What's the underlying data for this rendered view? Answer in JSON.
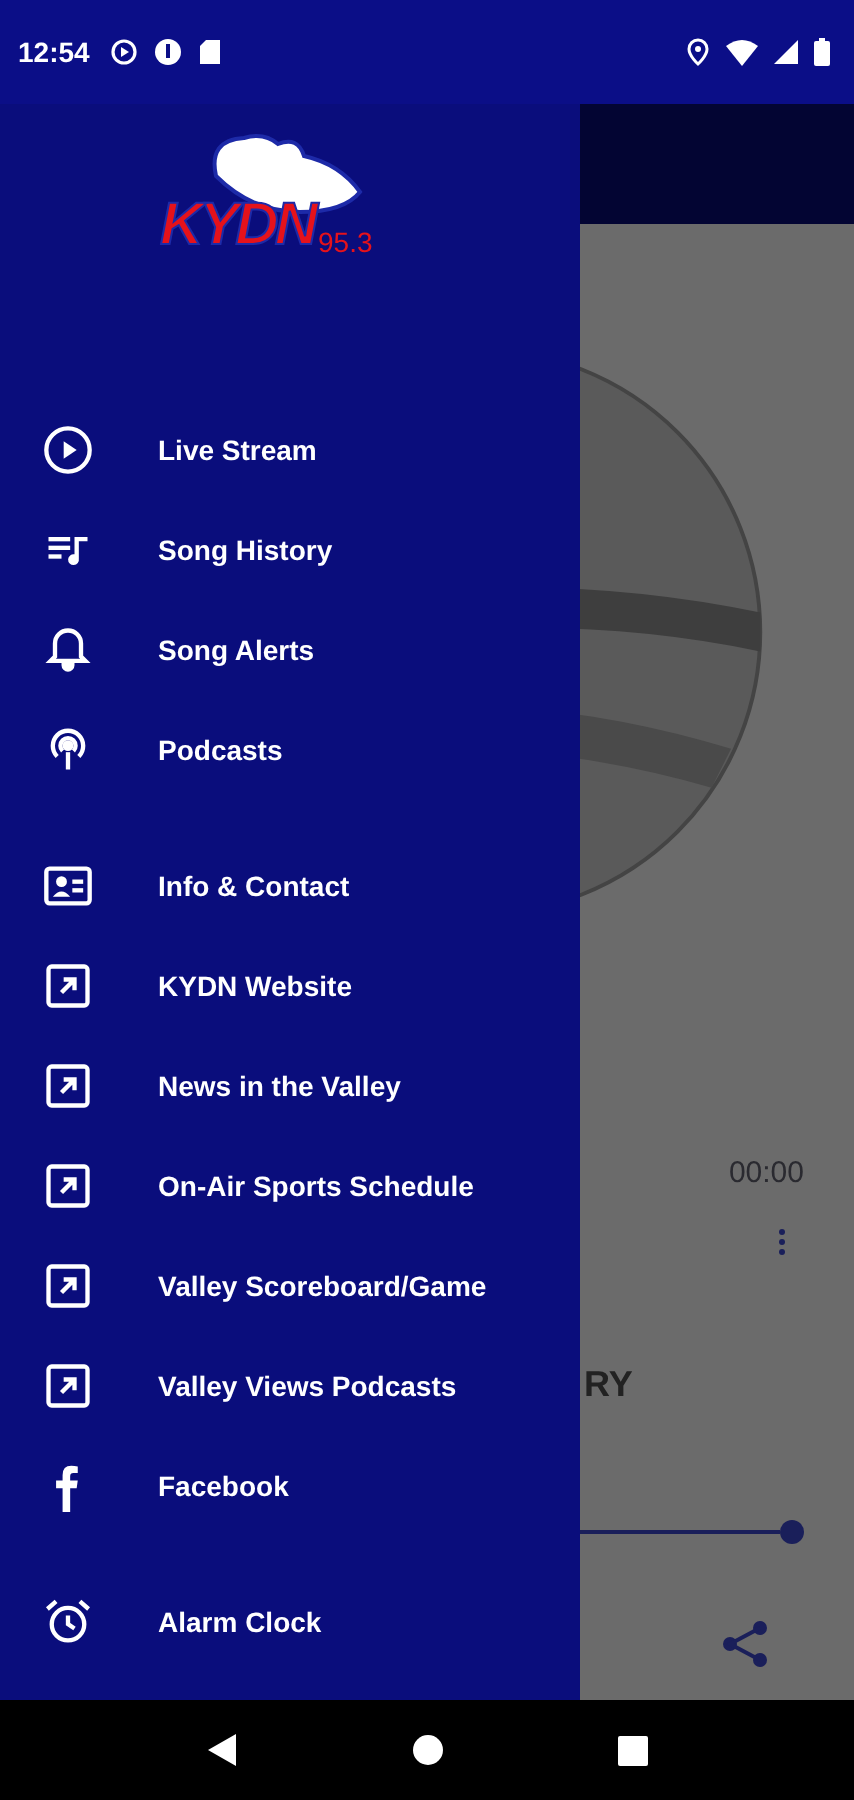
{
  "status_bar": {
    "time": "12:54"
  },
  "logo": {
    "name": "KYDN",
    "frequency": "95.3"
  },
  "drawer": {
    "sections": [
      {
        "items": [
          {
            "kind": "play",
            "label": "Live Stream"
          },
          {
            "kind": "queue",
            "label": "Song History"
          },
          {
            "kind": "bell",
            "label": "Song Alerts"
          },
          {
            "kind": "podcast",
            "label": "Podcasts"
          }
        ]
      },
      {
        "items": [
          {
            "kind": "contact",
            "label": "Info & Contact"
          },
          {
            "kind": "link",
            "label": "KYDN Website"
          },
          {
            "kind": "link",
            "label": "News in the Valley"
          },
          {
            "kind": "link",
            "label": "On-Air Sports Schedule"
          },
          {
            "kind": "link",
            "label": "Valley Scoreboard/Game"
          },
          {
            "kind": "link",
            "label": "Valley Views Podcasts"
          },
          {
            "kind": "facebook",
            "label": "Facebook"
          }
        ]
      },
      {
        "items": [
          {
            "kind": "alarm",
            "label": "Alarm Clock"
          }
        ]
      }
    ]
  },
  "player": {
    "elapsed": "00:00",
    "title": "RY",
    "seek": {
      "level": 1
    }
  }
}
